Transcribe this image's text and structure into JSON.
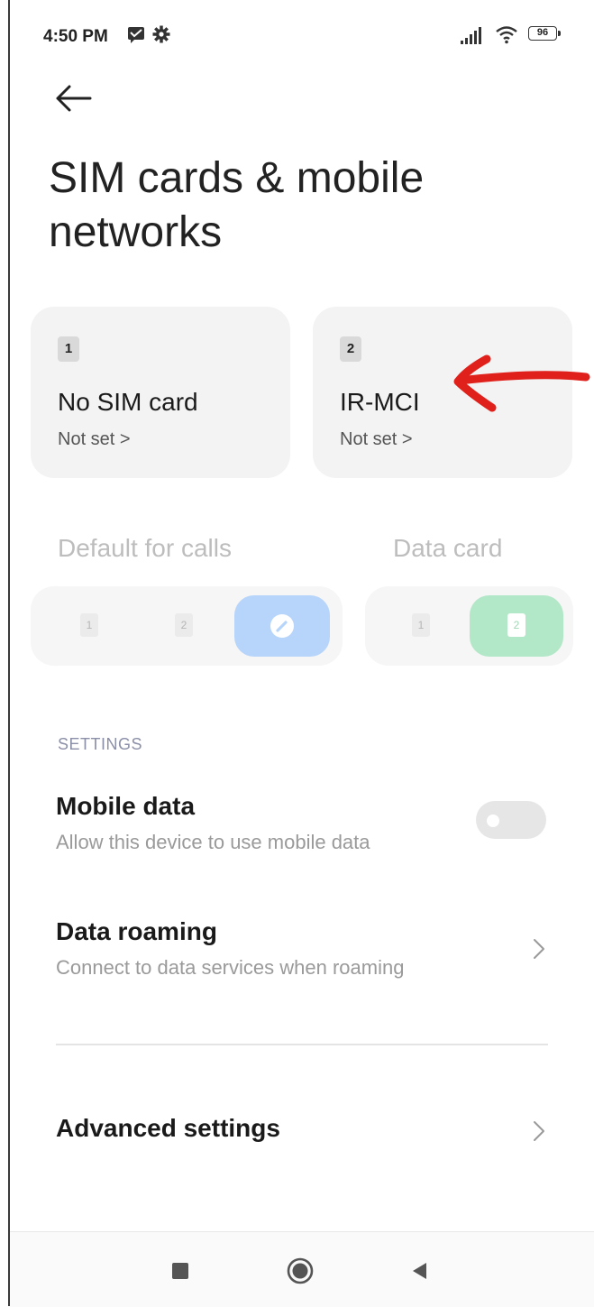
{
  "status_bar": {
    "time": "4:50 PM",
    "battery": "96",
    "icons": [
      "message-icon",
      "gear-icon",
      "signal-icon",
      "wifi-icon",
      "battery-icon"
    ]
  },
  "header": {
    "back_icon": "arrow-left-icon",
    "title": "SIM cards & mobile networks"
  },
  "sim_cards": [
    {
      "slot": "1",
      "name": "No SIM card",
      "status": "Not set >"
    },
    {
      "slot": "2",
      "name": "IR-MCI",
      "status": "Not set >"
    }
  ],
  "annotation": {
    "icon": "red-arrow-icon",
    "color": "#e0211b"
  },
  "defaults": {
    "calls": {
      "label": "Default for calls",
      "options": [
        "1",
        "2"
      ],
      "selected_icon": "ask-every-time-icon",
      "accent": "#b7d5fb"
    },
    "data": {
      "label": "Data card",
      "options": [
        "1",
        "2"
      ],
      "selected": "2",
      "accent": "#b2e7c8"
    }
  },
  "settings": {
    "header": "SETTINGS",
    "items": [
      {
        "title": "Mobile data",
        "subtitle": "Allow this device to use mobile data",
        "control": "toggle",
        "enabled": false
      },
      {
        "title": "Data roaming",
        "subtitle": "Connect to data services when roaming",
        "control": "chevron"
      },
      {
        "title": "Advanced settings",
        "subtitle": "",
        "control": "chevron"
      }
    ]
  },
  "nav_bar": {
    "icons": [
      "recents-icon",
      "home-icon",
      "back-triangle-icon"
    ]
  }
}
